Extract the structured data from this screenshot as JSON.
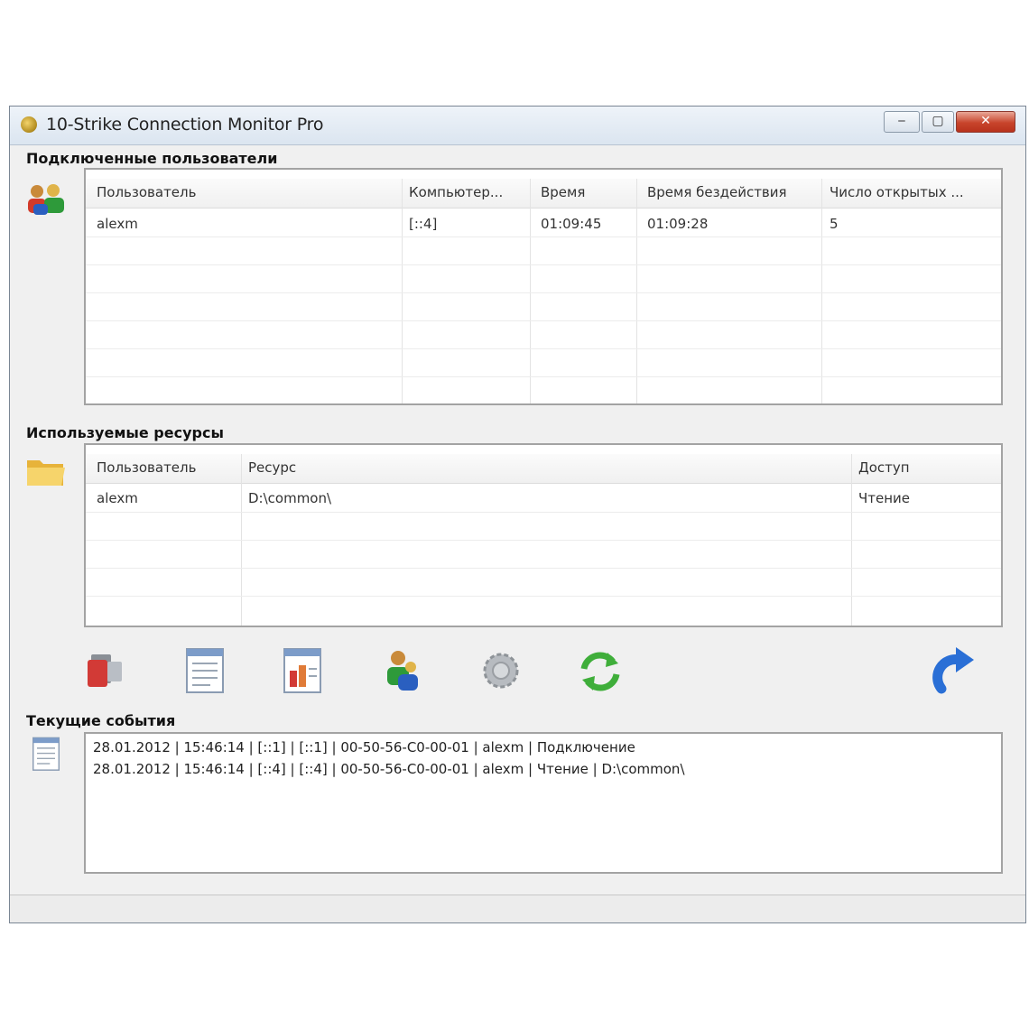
{
  "window": {
    "title": "10-Strike Connection Monitor Pro",
    "controls": {
      "minimize": "‒",
      "maximize": "▢",
      "close": "✕"
    }
  },
  "users_section": {
    "label": "Подключенные пользователи",
    "icon": "users-icon",
    "columns": [
      "Пользователь",
      "Компьютер...",
      "Время",
      "Время бездействия",
      "Число открытых ..."
    ],
    "rows": [
      {
        "user": "alexm",
        "computer": "[::4]",
        "time": "01:09:45",
        "idle": "01:09:28",
        "open": "5"
      }
    ]
  },
  "resources_section": {
    "label": "Используемые ресурсы",
    "icon": "folder-icon",
    "columns": [
      "Пользователь",
      "Ресурс",
      "Доступ"
    ],
    "rows": [
      {
        "user": "alexm",
        "resource": "D:\\common\\",
        "access": "Чтение"
      }
    ]
  },
  "toolbar": {
    "buttons": [
      {
        "name": "disconnect-user-button",
        "icon": "disconnect-icon"
      },
      {
        "name": "report-button",
        "icon": "report-icon"
      },
      {
        "name": "report-chart-button",
        "icon": "report-chart-icon"
      },
      {
        "name": "user-settings-button",
        "icon": "user-gear-icon"
      },
      {
        "name": "settings-button",
        "icon": "gear-icon"
      },
      {
        "name": "refresh-button",
        "icon": "refresh-icon"
      },
      {
        "name": "back-button",
        "icon": "undo-arrow-icon"
      }
    ]
  },
  "events_section": {
    "label": "Текущие события",
    "icon": "log-icon",
    "lines": [
      "28.01.2012 | 15:46:14 | [::1] | [::1] | 00-50-56-C0-00-01 | alexm | Подключение",
      "28.01.2012 | 15:46:14 | [::4] | [::4] | 00-50-56-C0-00-01 | alexm | Чтение | D:\\common\\"
    ]
  },
  "colors": {
    "title_bar": "#dbe5f0",
    "close_button": "#c8442c",
    "panel_border": "#a3a3a3",
    "window_bg": "#f0f0f0",
    "refresh_green": "#3fae3a",
    "arrow_blue": "#2a6fd6"
  }
}
